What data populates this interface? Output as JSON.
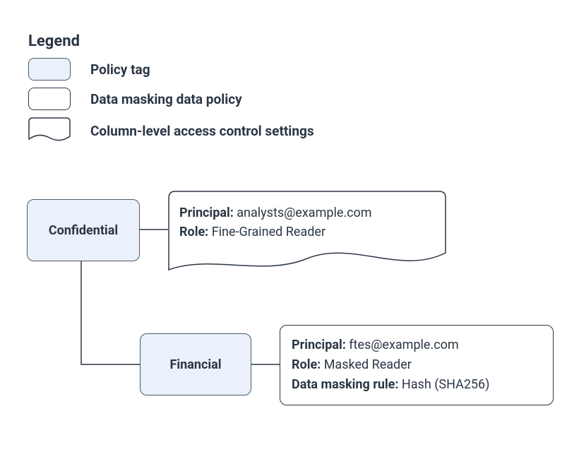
{
  "legend": {
    "title": "Legend",
    "items": [
      {
        "label": "Policy tag"
      },
      {
        "label": "Data masking data policy"
      },
      {
        "label": "Column-level access control settings"
      }
    ]
  },
  "nodes": {
    "confidential": {
      "label": "Confidential"
    },
    "financial": {
      "label": "Financial"
    }
  },
  "clacs": {
    "confidential": {
      "principal_key": "Principal:",
      "principal_val": "analysts@example.com",
      "role_key": "Role:",
      "role_val": "Fine-Grained Reader"
    }
  },
  "mask": {
    "financial": {
      "principal_key": "Principal:",
      "principal_val": "ftes@example.com",
      "role_key": "Role:",
      "role_val": "Masked Reader",
      "rule_key": "Data masking rule:",
      "rule_val": "Hash (SHA256)"
    }
  }
}
